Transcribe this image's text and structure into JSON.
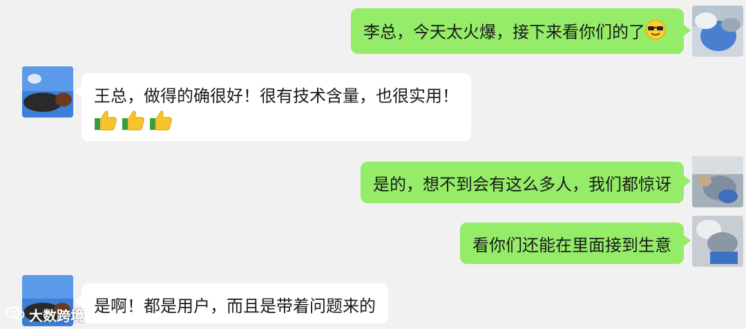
{
  "messages": [
    {
      "side": "right",
      "text": "李总，今天太火爆，接下来看你们的了",
      "emoji": "sunglasses-emoji"
    },
    {
      "side": "left",
      "text": "王总，做得的确很好！很有技术含量，也很实用！",
      "emoji": "thumbs-up-emoji",
      "emoji_count": 3
    },
    {
      "side": "right",
      "text": "是的，想不到会有这么多人，我们都惊讶"
    },
    {
      "side": "right",
      "text": "看你们还能在里面接到生意"
    },
    {
      "side": "left",
      "text": "是啊！都是用户，而且是带着问题来的"
    }
  ],
  "watermark": {
    "text": "大数跨境",
    "icon": "wechat-logo-icon"
  },
  "colors": {
    "background": "#f1f1f1",
    "sent_bubble": "#95ec69",
    "received_bubble": "#ffffff"
  }
}
